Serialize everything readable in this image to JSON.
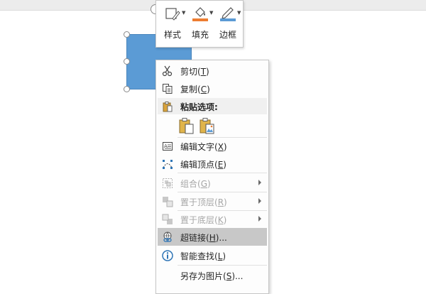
{
  "mini_toolbar": {
    "style_label": "样式",
    "fill_label": "填充",
    "border_label": "边框",
    "fill_color": "#ed7d31",
    "border_color": "#5b9bd5"
  },
  "shape": {
    "fill_color": "#5b9bd5"
  },
  "context_menu": {
    "cut": {
      "label": "剪切(",
      "key": "T",
      "close": ")"
    },
    "copy": {
      "label": "复制(",
      "key": "C",
      "close": ")"
    },
    "paste_options": {
      "label": "粘贴选项:"
    },
    "edit_text": {
      "label": "编辑文字(",
      "key": "X",
      "close": ")"
    },
    "edit_points": {
      "label": "编辑顶点(",
      "key": "E",
      "close": ")"
    },
    "group": {
      "label": "组合(",
      "key": "G",
      "close": ")"
    },
    "bring_to_front": {
      "label": "置于顶层(",
      "key": "R",
      "close": ")"
    },
    "send_to_back": {
      "label": "置于底层(",
      "key": "K",
      "close": ")"
    },
    "hyperlink": {
      "label": "超链接(",
      "key": "H",
      "close": ")..."
    },
    "smart_lookup": {
      "label": "智能查找(",
      "key": "L",
      "close": ")"
    },
    "save_as_picture": {
      "label": "另存为图片(",
      "key": "S",
      "close": ")..."
    }
  }
}
